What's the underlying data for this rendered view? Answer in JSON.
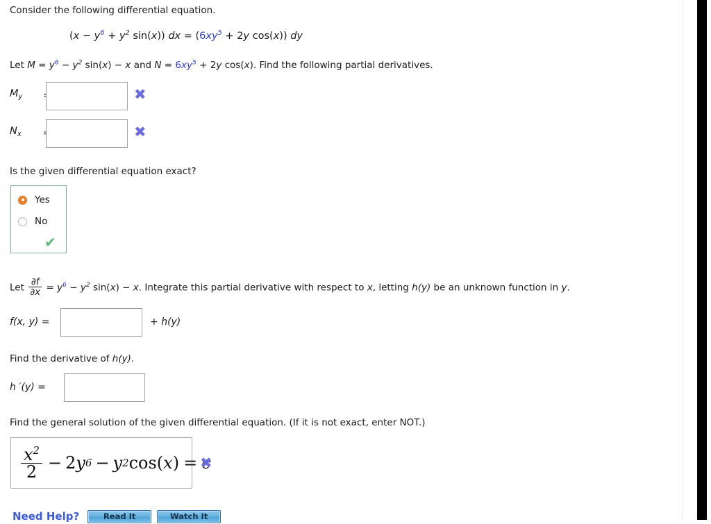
{
  "problem": {
    "intro": "Consider the following differential equation.",
    "equation": {
      "lhs_open": "(",
      "lhs": "x − y6 + y2 sin(x)) dx",
      "equals": "=",
      "rhs": "(6xy5 + 2y cos(x)) dy",
      "parts": {
        "p1": "(",
        "p2": "x",
        "p3": " − ",
        "p4": "y",
        "p5": "6",
        "p6": " + ",
        "p7": "y",
        "p8": "2",
        "p9": " sin(",
        "p10": "x",
        "p11": "))",
        "p12": "dx",
        "p13": "=",
        "p14": "(",
        "p15": "6",
        "p16": "xy",
        "p17": "5",
        "p18": " + 2",
        "p19": "y",
        "p20": " cos(",
        "p21": "x",
        "p22": "))",
        "p23": "dy"
      }
    },
    "definitions": {
      "lead": "Let ",
      "M_symbol": "M",
      "eq1": " = ",
      "m_y": "y",
      "m_y_exp": "6",
      "m_minus": " − ",
      "m_y2": "y",
      "m_y2_exp": "2",
      "m_sin": " sin(",
      "m_x": "x",
      "m_close": ") − ",
      "m_last_x": "x",
      "and": " and ",
      "N_symbol": "N",
      "eq2": " = ",
      "n_6": "6",
      "n_xy": "xy",
      "n_exp": "5",
      "n_plus": " + 2",
      "n_y": "y",
      "n_cos": " cos(",
      "n_x": "x",
      "n_tail": ").",
      "instruction": " Find the following partial derivatives."
    }
  },
  "partials": {
    "my": {
      "symbol": "M",
      "subscript": "y",
      "equals": "=",
      "value": "",
      "result_icon": "x-mark-icon"
    },
    "nx": {
      "symbol": "N",
      "subscript": "x",
      "equals": "=",
      "value": "",
      "result_icon": "x-mark-icon"
    }
  },
  "exactness": {
    "question": "Is the given differential equation exact?",
    "options": [
      {
        "label": "Yes",
        "selected": true
      },
      {
        "label": "No",
        "selected": false
      }
    ],
    "result_icon": "check-mark-icon"
  },
  "integration": {
    "lead": "Let ",
    "frac_num": "∂f",
    "frac_den": "∂x",
    "equals": " = ",
    "y": "y",
    "y_exp": "6",
    "minus": " − ",
    "y2": "y",
    "y2_exp": "2",
    "sin": " sin(",
    "x1": "x",
    "close": ") − ",
    "x2": "x",
    "tail": ". Integrate this partial derivative with respect to ",
    "x3": "x",
    "tail2": ", letting ",
    "h": "h",
    "hy": "(y)",
    "tail3": " be an unknown function in ",
    "y_end": "y",
    "period": ".",
    "answer_label_f": "f",
    "answer_label_args": "(x, y)",
    "answer_label_eq": " =",
    "answer_value": "",
    "answer_suffix_plus": "+ ",
    "answer_suffix_h": "h",
    "answer_suffix_y": "(y)"
  },
  "derivative": {
    "prompt_a": "Find the derivative of ",
    "prompt_h": "h",
    "prompt_y": "(y)",
    "prompt_end": ".",
    "label_h": "h",
    "label_prime": " ′",
    "label_y": "(y)",
    "label_eq": " =",
    "value": ""
  },
  "general_solution": {
    "prompt": "Find the general solution of the given differential equation. (If it is not exact, enter NOT.)",
    "answer": {
      "x": "x",
      "x_exp": "2",
      "denominator": "2",
      "minus1": "−",
      "coef2": "2",
      "y1": "y",
      "y1_exp": "6",
      "minus2": "−",
      "y2": "y",
      "y2_exp": "2",
      "cos": "cos",
      "paren_open": "(",
      "cos_arg": "x",
      "paren_close": ")",
      "equals": "=",
      "c": "c"
    },
    "result_icon": "x-mark-icon"
  },
  "need_help": {
    "label": "Need Help?",
    "buttons": [
      {
        "label": "Read It"
      },
      {
        "label": "Watch It"
      }
    ]
  },
  "icons": {
    "x_mark": "✖",
    "check_mark": "✔"
  }
}
